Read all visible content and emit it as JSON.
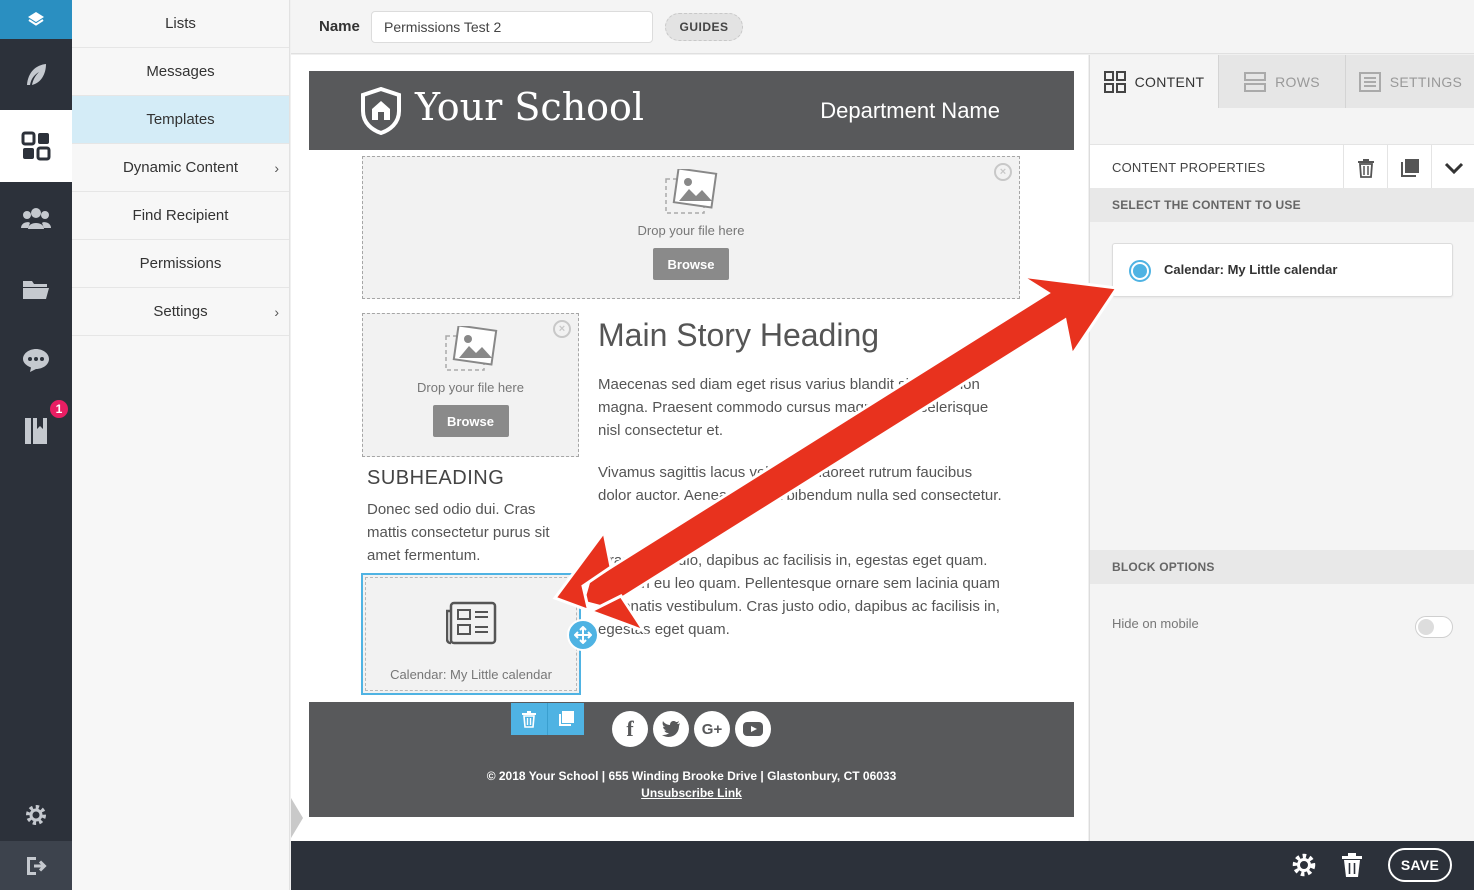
{
  "rail": {
    "badge_count": "1"
  },
  "sidemenu": {
    "items": [
      {
        "label": "Lists"
      },
      {
        "label": "Messages"
      },
      {
        "label": "Templates"
      },
      {
        "label": "Dynamic Content"
      },
      {
        "label": "Find Recipient"
      },
      {
        "label": "Permissions"
      },
      {
        "label": "Settings"
      }
    ],
    "active_index": 2
  },
  "topbar": {
    "name_label": "Name",
    "name_value": "Permissions Test 2",
    "guides_label": "GUIDES"
  },
  "email": {
    "school_name": "Your School",
    "department": "Department Name",
    "drop_text": "Drop your file here",
    "browse_label": "Browse",
    "main_heading": "Main Story Heading",
    "para1": "Maecenas sed diam eget risus varius blandit sit amet non magna. Praesent commodo cursus magna, vel scelerisque nisl consectetur et.",
    "para2": "Vivamus sagittis lacus vel augue laoreet rutrum faucibus dolor auctor. Aenean lacinia bibendum nulla sed consectetur.",
    "para3": "Cras justo odio, dapibus ac facilisis in, egestas eget quam. Aenean eu leo quam. Pellentesque ornare sem lacinia quam venenatis vestibulum. Cras justo odio, dapibus ac facilisis in, egestas eget quam.",
    "subheading": "SUBHEADING",
    "subpara": "Donec sed odio dui. Cras mattis consectetur purus sit amet fermentum.",
    "calendar_label": "Calendar: My Little calendar",
    "footer_line": "© 2018   Your School  |  655 Winding Brooke Drive  |  Glastonbury, CT 06033",
    "unsubscribe": "Unsubscribe Link"
  },
  "rpanel": {
    "tabs": [
      {
        "label": "CONTENT"
      },
      {
        "label": "ROWS"
      },
      {
        "label": "SETTINGS"
      }
    ],
    "content_properties": "CONTENT PROPERTIES",
    "select_content": "SELECT THE CONTENT TO USE",
    "selected_option": "Calendar: My Little calendar",
    "block_options": "BLOCK OPTIONS",
    "hide_on_mobile": "Hide on mobile"
  },
  "bottombar": {
    "save_label": "SAVE"
  },
  "colors": {
    "accent": "#4fb3e3",
    "rail": "#2c313a",
    "arrow": "#e8321e",
    "header_gray": "#58595b"
  }
}
